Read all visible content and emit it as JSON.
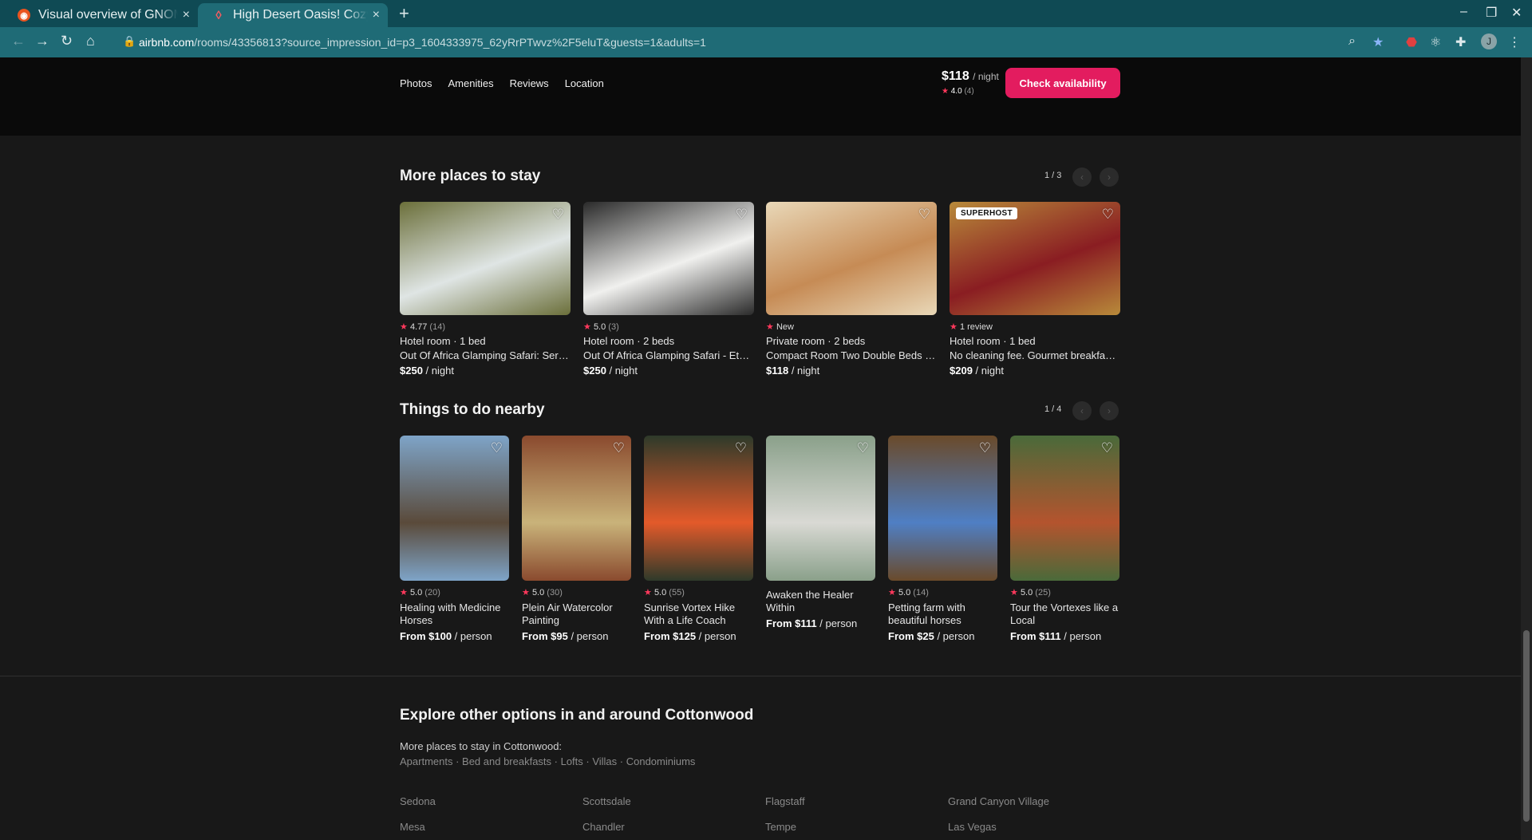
{
  "browser": {
    "tabs": [
      {
        "title": "Visual overview of GNOME",
        "close": "×"
      },
      {
        "title": "High Desert Oasis! Cozy home",
        "close": "×"
      }
    ],
    "new_tab": "+",
    "url_domain": "airbnb.com",
    "url_path": "/rooms/43356813?source_impression_id=p3_1604333975_62yRrPTwvz%2F5eluT&guests=1&adults=1",
    "profile_initial": "J"
  },
  "sticky_nav": {
    "links": [
      "Photos",
      "Amenities",
      "Reviews",
      "Location"
    ],
    "price": "$118",
    "per_night": "/ night",
    "rating": "4.0",
    "reviews_count": "(4)",
    "cta": "Check availability"
  },
  "more_places": {
    "title": "More places to stay",
    "pager": "1 / 3",
    "listings": [
      {
        "rating": "4.77",
        "count": "(14)",
        "type": "Hotel room · 1 bed",
        "title": "Out Of Africa Glamping Safari: Serengeti",
        "price": "$250",
        "unit": "/ night",
        "badge": "",
        "colors": [
          "#dfe5e4",
          "#6b6f3a"
        ]
      },
      {
        "rating": "5.0",
        "count": "(3)",
        "type": "Hotel room · 2 beds",
        "title": "Out Of Africa Glamping Safari - Etosha",
        "price": "$250",
        "unit": "/ night",
        "badge": "",
        "colors": [
          "#f0f0ee",
          "#2a2a2a"
        ]
      },
      {
        "rating": "New",
        "count": "",
        "type": "Private room · 2 beds",
        "title": "Compact Room Two Double Beds with Views",
        "price": "$118",
        "unit": "/ night",
        "badge": "",
        "colors": [
          "#c68b55",
          "#e9d8b8"
        ]
      },
      {
        "rating": "1 review",
        "count": "",
        "type": "Hotel room · 1 bed",
        "title": "No cleaning fee. Gourmet breakfast included",
        "price": "$209",
        "unit": "/ night",
        "badge": "SUPERHOST",
        "colors": [
          "#8a1d22",
          "#b88a3a"
        ]
      }
    ]
  },
  "things_to_do": {
    "title": "Things to do nearby",
    "pager": "1 / 4",
    "experiences": [
      {
        "rating": "5.0",
        "count": "(20)",
        "title": "Healing with Medicine Horses",
        "from": "From",
        "price": "$100",
        "unit": "/ person",
        "colors": [
          "#5a4a3a",
          "#7ea4c8"
        ]
      },
      {
        "rating": "5.0",
        "count": "(30)",
        "title": "Plein Air Watercolor Painting",
        "from": "From",
        "price": "$95",
        "unit": "/ person",
        "colors": [
          "#c9b37a",
          "#8a4a2e"
        ]
      },
      {
        "rating": "5.0",
        "count": "(55)",
        "title": "Sunrise Vortex Hike With a Life Coach",
        "from": "From",
        "price": "$125",
        "unit": "/ person",
        "colors": [
          "#e35a2a",
          "#2e3a2a"
        ]
      },
      {
        "rating": "",
        "count": "",
        "title": "Awaken the Healer Within",
        "from": "From",
        "price": "$111",
        "unit": "/ person",
        "colors": [
          "#d9d9d4",
          "#8aa08a"
        ]
      },
      {
        "rating": "5.0",
        "count": "(14)",
        "title": "Petting farm with beautiful horses",
        "from": "From",
        "price": "$25",
        "unit": "/ person",
        "colors": [
          "#4f7fc4",
          "#6a4a2a"
        ]
      },
      {
        "rating": "5.0",
        "count": "(25)",
        "title": "Tour the Vortexes like a Local",
        "from": "From",
        "price": "$111",
        "unit": "/ person",
        "colors": [
          "#b4542e",
          "#4a6a3a"
        ]
      }
    ]
  },
  "explore": {
    "title": "Explore other options in and around Cottonwood",
    "subtitle": "More places to stay in Cottonwood:",
    "links": "Apartments · Bed and breakfasts · Lofts · Villas · Condominiums",
    "cities": [
      "Sedona",
      "Scottsdale",
      "Flagstaff",
      "Grand Canyon Village",
      "Mesa",
      "Chandler",
      "Tempe",
      "Las Vegas"
    ]
  },
  "colors": {
    "accent": "#e31c5f",
    "star": "#ff385c",
    "chrome": "#1f6b76"
  }
}
